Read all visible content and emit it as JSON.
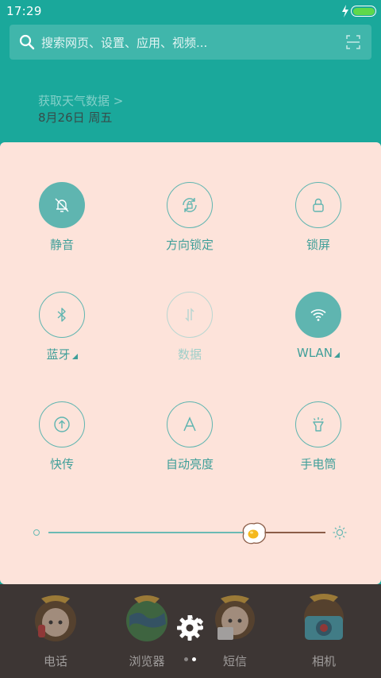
{
  "status_bar": {
    "time": "17:29",
    "battery_level": 1.0
  },
  "search": {
    "placeholder": "搜索网页、设置、应用、视频..."
  },
  "weather": {
    "link_label": "获取天气数据 >",
    "date": "8月26日 周五"
  },
  "toggles": [
    {
      "id": "mute",
      "label": "静音",
      "state": "on",
      "icon": "bell-off-icon"
    },
    {
      "id": "rotation-lock",
      "label": "方向锁定",
      "state": "off",
      "icon": "rotation-lock-icon"
    },
    {
      "id": "lock-screen",
      "label": "锁屏",
      "state": "off",
      "icon": "padlock-icon"
    },
    {
      "id": "bluetooth",
      "label": "蓝牙",
      "state": "off",
      "icon": "bluetooth-icon",
      "has_menu": true
    },
    {
      "id": "data",
      "label": "数据",
      "state": "disabled",
      "icon": "data-arrows-icon"
    },
    {
      "id": "wlan",
      "label": "WLAN",
      "state": "on",
      "icon": "wifi-icon",
      "has_menu": true
    },
    {
      "id": "fast-transfer",
      "label": "快传",
      "state": "off",
      "icon": "upload-icon"
    },
    {
      "id": "auto-brightness",
      "label": "自动亮度",
      "state": "off",
      "icon": "letter-a-icon"
    },
    {
      "id": "flashlight",
      "label": "手电筒",
      "state": "off",
      "icon": "flashlight-icon"
    }
  ],
  "brightness": {
    "level": 0.74
  },
  "dock": {
    "apps": [
      {
        "label": "电话",
        "icon": "phone-app-icon"
      },
      {
        "label": "浏览器",
        "icon": "browser-app-icon"
      },
      {
        "label": "短信",
        "icon": "messages-app-icon"
      },
      {
        "label": "相机",
        "icon": "camera-app-icon"
      }
    ],
    "page_count": 2,
    "current_page": 2
  },
  "colors": {
    "header_bg": "#1aa89b",
    "panel_bg": "#fde3da",
    "accent": "#5fb5b0",
    "battery": "#5fd84b"
  }
}
